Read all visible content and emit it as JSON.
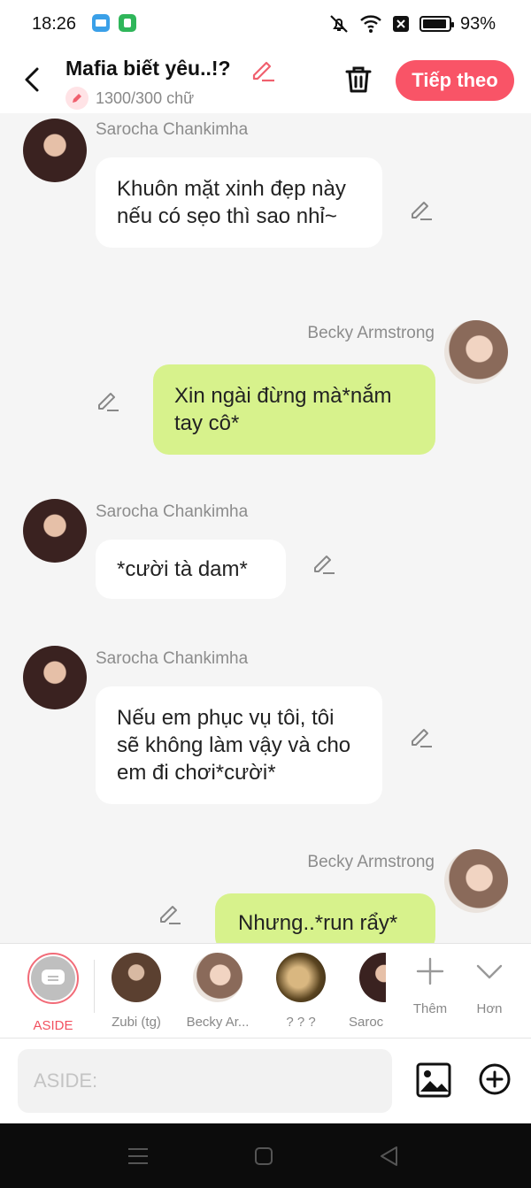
{
  "status_bar": {
    "time": "18:26",
    "battery": "93%",
    "icons": [
      "novel-toon-app-icon",
      "shield-app-icon",
      "mute-icon",
      "wifi-icon",
      "sim-off-icon",
      "battery-icon"
    ]
  },
  "header": {
    "title": "Mafia biết yêu..!?",
    "word_count": "1300/300 chữ",
    "next_label": "Tiếp theo"
  },
  "messages": [
    {
      "sender": "Sarocha Chankimha",
      "side": "left",
      "text": "Khuôn mặt xinh đẹp này nếu có sẹo thì sao nhỉ~"
    },
    {
      "sender": "Becky Armstrong",
      "side": "right",
      "text": "Xin ngài đừng mà*nắm tay cô*"
    },
    {
      "sender": "Sarocha Chankimha",
      "side": "left",
      "text": "*cười tà dam*"
    },
    {
      "sender": "Sarocha Chankimha",
      "side": "left",
      "text": "Nếu em phục vụ tôi, tôi sẽ không làm vậy và cho em đi chơi*cười*"
    },
    {
      "sender": "Becky Armstrong",
      "side": "right",
      "text": "Nhưng..*run rẩy*"
    }
  ],
  "characters": [
    {
      "name": "ASIDE",
      "active": true
    },
    {
      "name": "Zubi (tg)"
    },
    {
      "name": "Becky Ar..."
    },
    {
      "name": "? ? ?"
    },
    {
      "name": "Saroc"
    }
  ],
  "tools": {
    "more_label": "Thêm",
    "less_label": "Hơn"
  },
  "input": {
    "placeholder": "ASIDE:"
  },
  "colors": {
    "accent": "#f95467",
    "green_bubble": "#d7f28c",
    "white_bubble": "#ffffff",
    "background": "#f5f5f5"
  }
}
